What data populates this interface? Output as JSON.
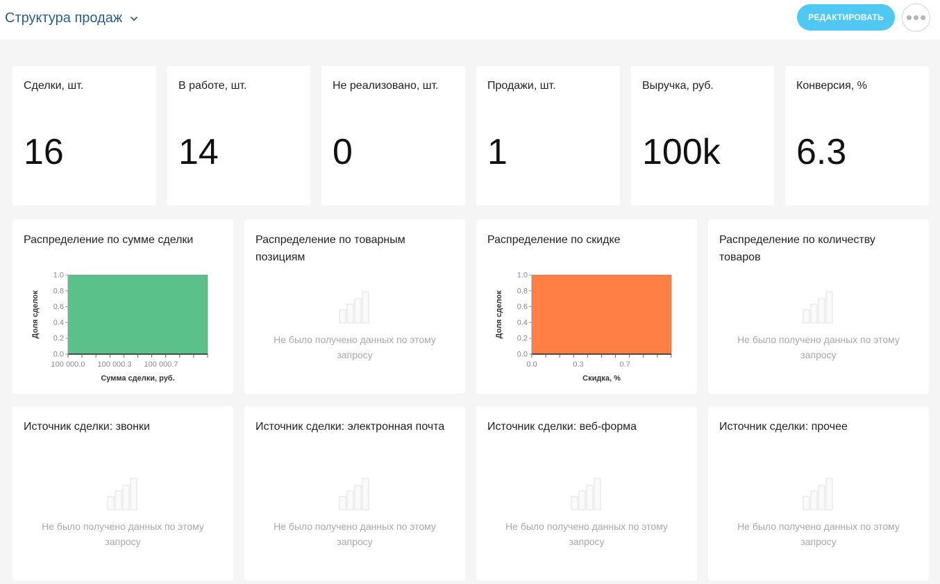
{
  "header": {
    "title": "Структура продаж",
    "edit_label": "РЕДАКТИРОВАТЬ"
  },
  "kpis": [
    {
      "label": "Сделки, шт.",
      "value": "16"
    },
    {
      "label": "В работе, шт.",
      "value": "14"
    },
    {
      "label": "Не реализовано, шт.",
      "value": "0"
    },
    {
      "label": "Продажи, шт.",
      "value": "1"
    },
    {
      "label": "Выручка, руб.",
      "value": "100k"
    },
    {
      "label": "Конверсия, %",
      "value": "6.3"
    }
  ],
  "empty_text": "Не было получено данных по этому запросу",
  "cards": {
    "amount": {
      "title": "Распределение по сумме сделки"
    },
    "items": {
      "title": "Распределение по товарным позициям"
    },
    "discount": {
      "title": "Распределение по скидке"
    },
    "quantity": {
      "title": "Распределение по количеству товаров"
    },
    "calls": {
      "title": "Источник сделки: звонки"
    },
    "email": {
      "title": "Источник сделки: электронная почта"
    },
    "webform": {
      "title": "Источник сделки: веб-форма"
    },
    "other": {
      "title": "Источник сделки: прочее"
    }
  },
  "colors": {
    "accent": "#4fc8f4",
    "title_blue": "#2a5e8c",
    "green": "#5ac18a",
    "orange": "#ff7f45",
    "empty_text": "#a8a8a8"
  },
  "chart_data": [
    {
      "type": "bar",
      "xlabel": "Сумма сделки, руб.",
      "ylabel": "Доля сделок",
      "x_ticks": [
        "100 000.0",
        "100 000.3",
        "100 000.7"
      ],
      "y_ticks": [
        "1.0",
        "0.8",
        "0.6",
        "0.4",
        "0.2",
        "0.0"
      ],
      "ylim": [
        0,
        1
      ],
      "xlim": [
        0,
        1
      ],
      "bins": [
        {
          "x0": 0,
          "x1": 1,
          "value": 1.0
        }
      ],
      "color": "#5ac18a"
    },
    {
      "type": "bar",
      "xlabel": "Скидка, %",
      "ylabel": "Доля сделок",
      "x_ticks": [
        "0.0",
        "0.3",
        "0.7"
      ],
      "y_ticks": [
        "1.0",
        "0.8",
        "0.6",
        "0.4",
        "0.2",
        "0.0"
      ],
      "ylim": [
        0,
        1
      ],
      "xlim": [
        0,
        1
      ],
      "bins": [
        {
          "x0": 0,
          "x1": 1,
          "value": 1.0
        }
      ],
      "color": "#ff7f45"
    }
  ]
}
